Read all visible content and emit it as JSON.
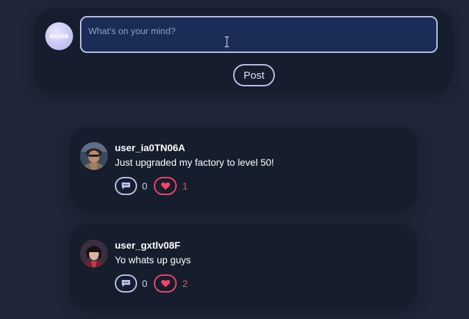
{
  "composer": {
    "avatar_text": "NOOB",
    "placeholder": "What's on your mind?",
    "post_label": "Post"
  },
  "posts": [
    {
      "username": "user_ia0TN06A",
      "text": "Just upgraded my factory to level 50!",
      "comments": "0",
      "likes": "1"
    },
    {
      "username": "user_gxtlv08F",
      "text": "Yo whats up guys",
      "comments": "0",
      "likes": "2"
    }
  ],
  "colors": {
    "background": "#1e2637",
    "card": "#161e2d",
    "input_bg": "#1b2d56",
    "accent_outline": "#b8c4ee",
    "like": "#f0456a"
  },
  "icons": {
    "comment": "comment-bubble-icon",
    "like": "heart-icon"
  }
}
